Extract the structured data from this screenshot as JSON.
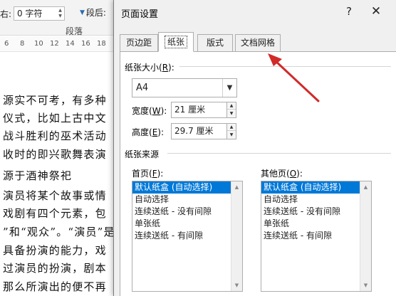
{
  "ribbon": {
    "indent_right_label": "右:",
    "indent_right_value": "0 字符",
    "spacing_after_label": "段后:",
    "paragraph_group_label": "段落"
  },
  "ruler": {
    "numbers": [
      "6",
      "8",
      "10",
      "12",
      "14",
      "16",
      "18"
    ]
  },
  "document": {
    "lines": [
      "源实不可考，有多种",
      "仪式，比如上古中文",
      "战斗胜利的巫术活动",
      "收时的即兴歌舞表演",
      "源于酒神祭祀",
      "演员将某个故事或情",
      "戏剧有四个元素，包",
      "”和“观众”。“演员”是",
      "具备扮演的能力，戏",
      "过演员的扮演，剧本",
      "那么所演出的便不再"
    ]
  },
  "dialog": {
    "title": "页面设置",
    "help_glyph": "?",
    "close_glyph": "✕",
    "tabs": [
      {
        "label": "页边距"
      },
      {
        "label": "纸张"
      },
      {
        "label": "版式"
      },
      {
        "label": "文档网格"
      }
    ],
    "active_tab": "纸张",
    "paper_size": {
      "label": "纸张大小",
      "accel": "R",
      "selected": "A4",
      "width_label": "宽度",
      "width_accel": "W",
      "width_value": "21 厘米",
      "height_label": "高度",
      "height_accel": "E",
      "height_value": "29.7 厘米"
    },
    "paper_source": {
      "label": "纸张来源",
      "first_page": {
        "label": "首页",
        "accel": "F",
        "items": [
          "默认纸盒 (自动选择)",
          "自动选择",
          "连续送纸 - 没有间隙",
          "单张纸",
          "连续送纸 - 有间隙"
        ],
        "selected_index": 0
      },
      "other_pages": {
        "label": "其他页",
        "accel": "O",
        "items": [
          "默认纸盒 (自动选择)",
          "自动选择",
          "连续送纸 - 没有间隙",
          "单张纸",
          "连续送纸 - 有间隙"
        ],
        "selected_index": 0
      }
    }
  },
  "colors": {
    "selection": "#0078d7",
    "annotation_arrow": "#d12a2a"
  },
  "icons": [
    "chevron-down-icon",
    "spin-up-icon",
    "spin-down-icon",
    "scroll-up-icon",
    "scroll-down-icon",
    "close-icon",
    "help-icon"
  ]
}
